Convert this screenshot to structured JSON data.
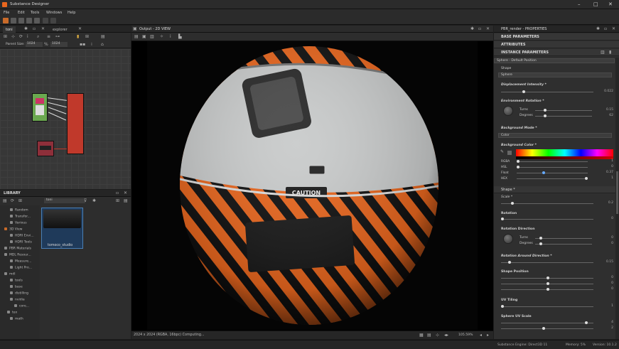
{
  "app": {
    "title": "Substance Designer"
  },
  "window": {
    "minimize": "–",
    "maximize": "□",
    "close": "✕"
  },
  "menu": [
    "File",
    "Edit",
    "Tools",
    "Windows",
    "Help"
  ],
  "graph_panel": {
    "tabs": [
      "toni",
      "explorer"
    ],
    "preset_label": "Parent Size:",
    "size_a": "1024",
    "size_b": "1024"
  },
  "library": {
    "title": "LIBRARY",
    "search_value": "toni",
    "tree": [
      "Random",
      "Transfor...",
      "Various",
      "3D View",
      "HDRI Envi...",
      "HDRI Tools",
      "PBR Materials",
      "MDL Resour...",
      "Measure...",
      "Light Pro...",
      "mdl",
      "tools",
      "base",
      "distilling",
      "nvidia",
      "core...",
      "tex",
      "math"
    ],
    "thumbnail_label": "tomoco_studio"
  },
  "viewport": {
    "title": "Output - 2D VIEW",
    "status": "2024 x 2024 (RGBA, 16bpc) Computing...",
    "zoom": "105.59%"
  },
  "properties": {
    "title": "PBR_render - PROPERTIES",
    "sections": [
      "BASE PARAMETERS",
      "ATTRIBUTES",
      "INSTANCE PARAMETERS"
    ],
    "preset": "Sphere - Default Position",
    "shape_label": "Shape",
    "shape_value": "Sphere",
    "displacement_label": "Displacement Intensity *",
    "displacement_value": "0.022",
    "env_rot_label": "Environment Rotation *",
    "turns_label": "Turns",
    "turns_value": "0.15",
    "degrees_label": "Degrees",
    "degrees_value": "62",
    "bg_mode_label": "Background Mode *",
    "bg_mode_value": "Color",
    "bg_color_label": "Background Color *",
    "rgba_label": "RGBA",
    "hsl_label": "HSL",
    "float_label": "Float",
    "hex_label": "HEX",
    "bg_values": [
      "1",
      "0",
      "0.37",
      "1"
    ],
    "shape_section": "Shape *",
    "scale_label": "Scale *",
    "scale_value": "0.2",
    "rotation_label": "Rotation",
    "rotation_value": "0",
    "rot_dir_label": "Rotation Direction",
    "rot_dir_turns": "0",
    "rot_dir_degrees": "0",
    "rot_around_label": "Rotation Around Direction *",
    "rot_around_value": "0.15",
    "shape_pos_label": "Shape Position",
    "shape_pos_values": [
      "0",
      "0",
      "0"
    ],
    "uv_tiling_label": "UV Tiling",
    "uv_tiling_value": "1",
    "sphere_uv_label": "Sphere UV Scale",
    "sphere_uv_values": [
      "4",
      "2"
    ]
  },
  "status_bar": {
    "engine": "Substance Engine: Direct3D 11",
    "memory": "Memory: 5%",
    "version": "Version: 10.1.2"
  },
  "colors": {
    "accent": "#e8661e",
    "node_red": "#c0392b",
    "node_green": "#5aa02c"
  }
}
